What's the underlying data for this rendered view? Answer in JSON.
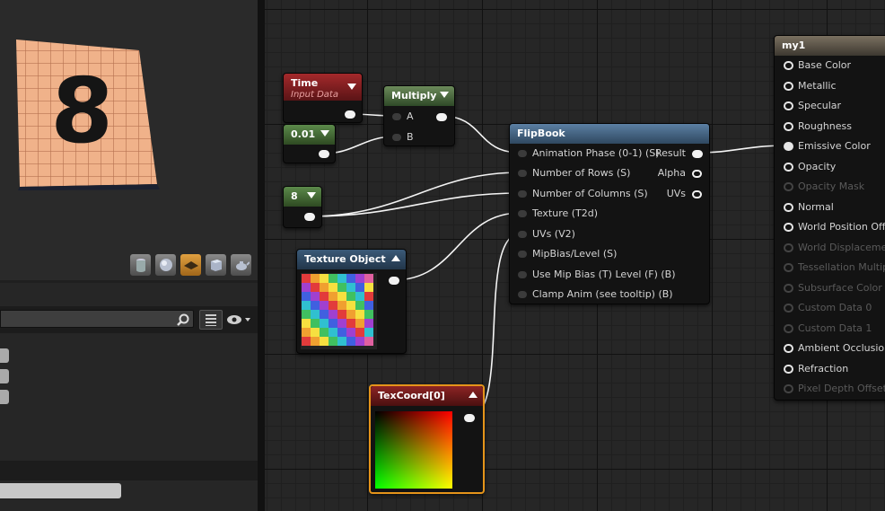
{
  "preview": {
    "number": "8",
    "buttons": [
      {
        "name": "cylinder-icon"
      },
      {
        "name": "sphere-icon"
      },
      {
        "name": "plane-icon",
        "active": true
      },
      {
        "name": "cube-icon"
      },
      {
        "name": "teapot-icon"
      }
    ]
  },
  "details": {
    "search_value": "",
    "row_count": 3
  },
  "nodes": {
    "time": {
      "title": "Time",
      "subtitle": "Input Data"
    },
    "const_001": {
      "value": "0.01"
    },
    "const_8": {
      "value": "8"
    },
    "multiply": {
      "title": "Multiply",
      "inputs": [
        "A",
        "B"
      ]
    },
    "flipbook": {
      "title": "FlipBook",
      "inputs": [
        "Animation  Phase (0-1) (S)",
        "Number of Rows (S)",
        "Number of Columns (S)",
        "Texture (T2d)",
        "UVs (V2)",
        "MipBias/Level (S)",
        "Use Mip Bias (T) Level (F) (B)",
        "Clamp Anim (see tooltip) (B)"
      ],
      "outputs": [
        "Result",
        "Alpha",
        "UVs"
      ]
    },
    "texture_object": {
      "title": "Texture Object"
    },
    "texcoord": {
      "title": "TexCoord[0]"
    },
    "material": {
      "title": "my1",
      "inputs": [
        {
          "label": "Base Color",
          "enabled": true
        },
        {
          "label": "Metallic",
          "enabled": true
        },
        {
          "label": "Specular",
          "enabled": true
        },
        {
          "label": "Roughness",
          "enabled": true
        },
        {
          "label": "Emissive Color",
          "enabled": true,
          "connected": true
        },
        {
          "label": "Opacity",
          "enabled": true
        },
        {
          "label": "Opacity Mask",
          "enabled": false
        },
        {
          "label": "Normal",
          "enabled": true
        },
        {
          "label": "World Position Offset",
          "enabled": true
        },
        {
          "label": "World Displacement",
          "enabled": false
        },
        {
          "label": "Tessellation Multiplier",
          "enabled": false
        },
        {
          "label": "Subsurface Color",
          "enabled": false
        },
        {
          "label": "Custom Data 0",
          "enabled": false
        },
        {
          "label": "Custom Data 1",
          "enabled": false
        },
        {
          "label": "Ambient Occlusion",
          "enabled": true
        },
        {
          "label": "Refraction",
          "enabled": true
        },
        {
          "label": "Pixel Depth Offset",
          "enabled": false
        }
      ]
    }
  },
  "colors": {
    "graph_bg": "#262626",
    "node_body": "#131313",
    "selection": "#e5941a",
    "flipbook_header": "#3e5c7a",
    "time_header": "#8c2326",
    "constant_header": "#4d7a3c",
    "wire": "#ffffff"
  }
}
